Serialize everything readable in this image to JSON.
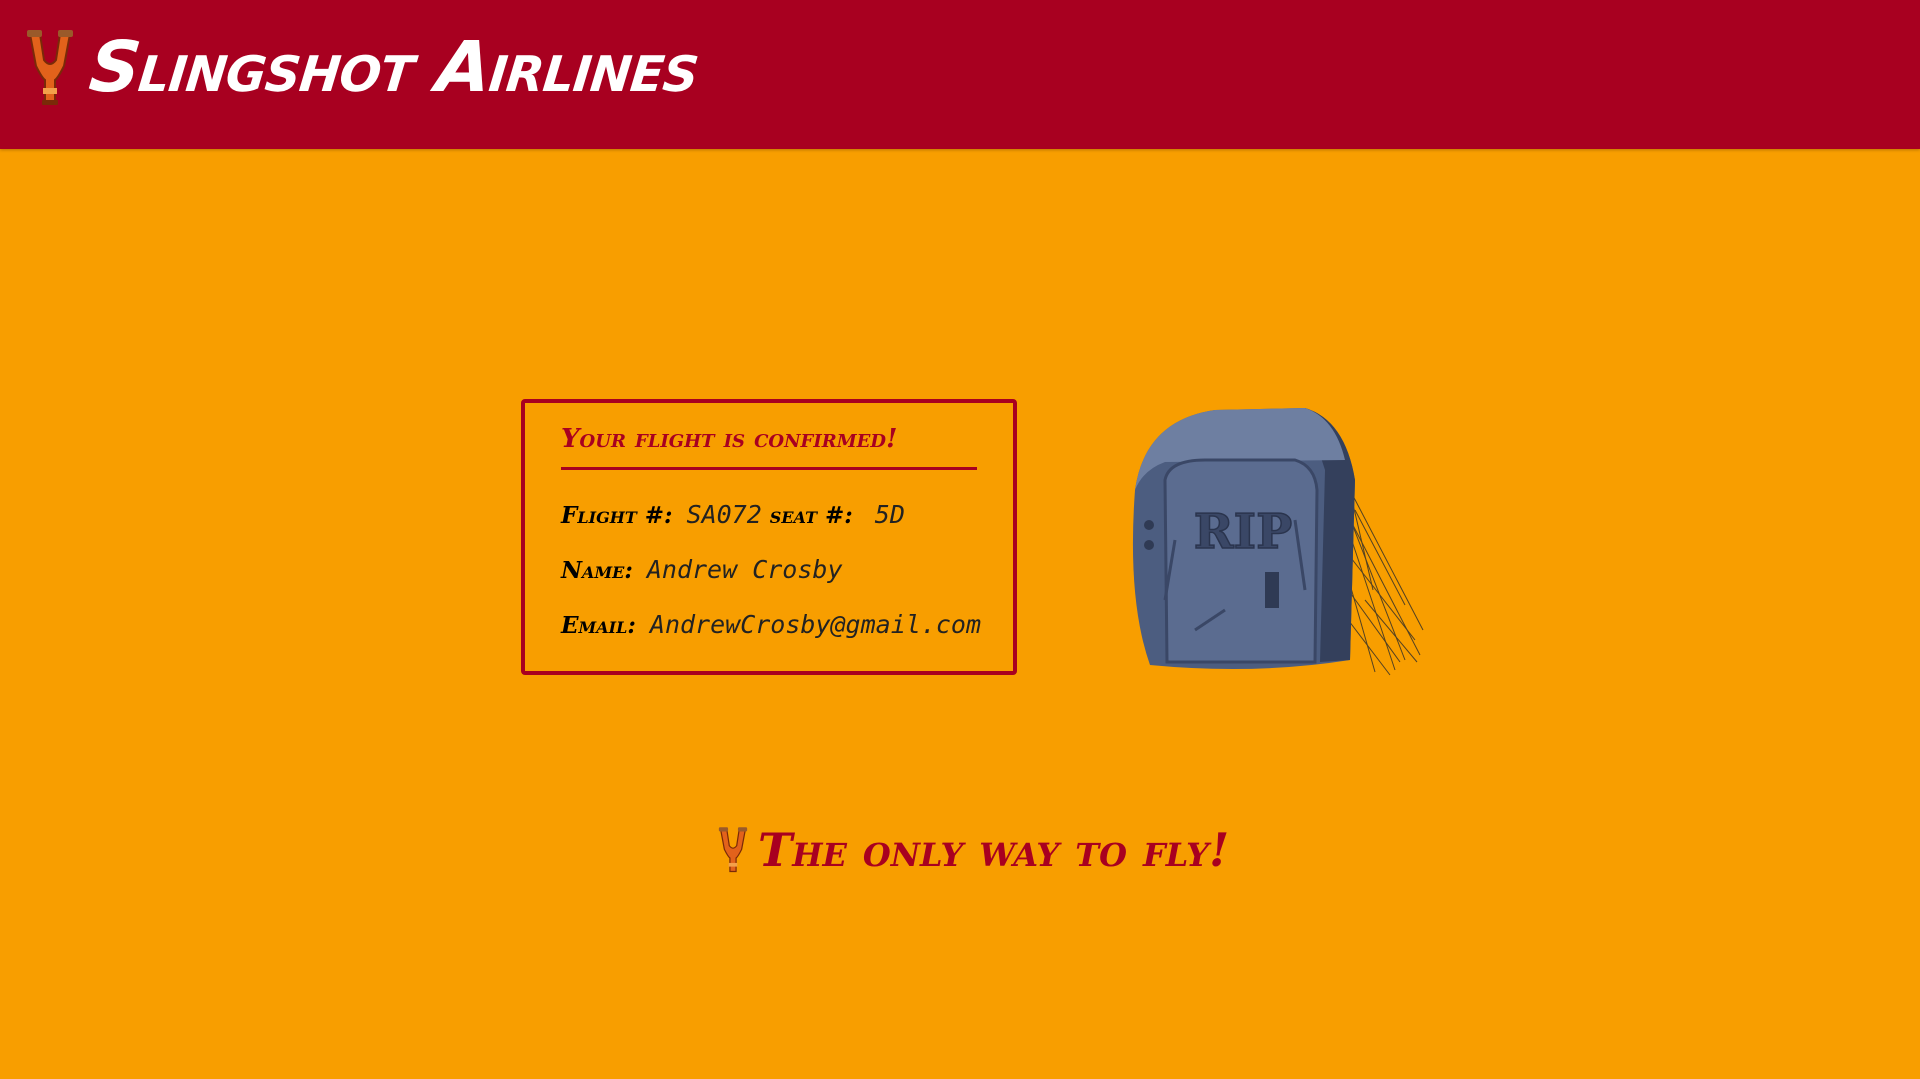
{
  "header": {
    "brand": "Slingshot Airlines",
    "logo_icon": "slingshot-icon"
  },
  "confirmation": {
    "title": "Your flight is confirmed!",
    "flight_label": "Flight #:",
    "flight_value": "SA072",
    "seat_label": "seat #:",
    "seat_value": "5D",
    "name_label": "Name:",
    "name_value": "Andrew Crosby",
    "email_label": "Email:",
    "email_value": "AndrewCrosby@gmail.com"
  },
  "illustration": {
    "text": "RIP",
    "icon": "tombstone-icon"
  },
  "footer": {
    "tagline": "The only way to fly!",
    "icon": "slingshot-icon"
  },
  "colors": {
    "background": "#F89E00",
    "header": "#A80020",
    "accent": "#A80020"
  }
}
